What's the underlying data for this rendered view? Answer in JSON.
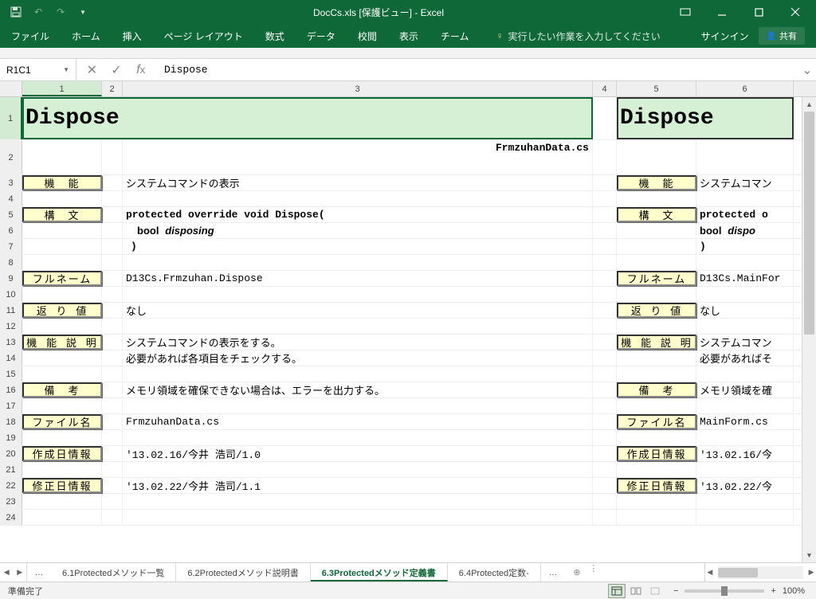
{
  "titlebar": {
    "doc": "DocCs.xls  [保護ビュー] - Excel"
  },
  "ribbon": {
    "tabs": [
      "ファイル",
      "ホーム",
      "挿入",
      "ページ レイアウト",
      "数式",
      "データ",
      "校閲",
      "表示",
      "チーム"
    ],
    "tell_me": "実行したい作業を入力してください",
    "signin": "サインイン",
    "share": "共有"
  },
  "formula": {
    "name_box": "R1C1",
    "value": "Dispose"
  },
  "columns": {
    "c1": "1",
    "c2": "2",
    "c3": "3",
    "c4": "4",
    "c5": "5",
    "c6": "6"
  },
  "rows": {
    "title_left": "Dispose",
    "title_right": "Dispose",
    "r2_c3": "FrmzuhanData.cs",
    "lbl_func": "機　能",
    "r3_c3": "システムコマンドの表示",
    "r3_c6": "システムコマン",
    "lbl_syntax": "構　文",
    "r5_c3": "protected override void Dispose(",
    "r5_c6a": "protected o",
    "r6_c3": "bool",
    "r6_c3i": "disposing",
    "r6_c6a": "bool",
    "r6_c6b": "dispo",
    "r7_c3": ")",
    "r7_c6": ")",
    "lbl_fullname": "フルネーム",
    "r9_c3": "D13Cs.Frmzuhan.Dispose",
    "r9_c6": "D13Cs.MainFor",
    "lbl_return": "返 り 値",
    "r11_c3": "なし",
    "r11_c6": "なし",
    "lbl_desc": "機 能 説 明",
    "r13_c3": "システムコマンドの表示をする。",
    "r13_c6": "システムコマン",
    "r14_c3": "必要があれば各項目をチェックする。",
    "r14_c6": "必要があればそ",
    "lbl_note": "備　考",
    "r16_c3": "メモリ領域を確保できない場合は、エラーを出力する。",
    "r16_c6": "メモリ領域を確",
    "lbl_file": "ファイル名",
    "r18_c3": "FrmzuhanData.cs",
    "r18_c6": "MainForm.cs",
    "lbl_created": "作成日情報",
    "r20_c3": "'13.02.16/今井 浩司/1.0",
    "r20_c6": "'13.02.16/今",
    "lbl_modified": "修正日情報",
    "r22_c3": "'13.02.22/今井 浩司/1.1",
    "r22_c6": "'13.02.22/今"
  },
  "sheets": {
    "t1": "6.1Protectedメソッド一覧",
    "t2": "6.2Protectedメソッド説明書",
    "t3": "6.3Protectedメソッド定義書",
    "t4": "6.4Protected定数-"
  },
  "status": {
    "ready": "準備完了",
    "zoom": "100%"
  }
}
